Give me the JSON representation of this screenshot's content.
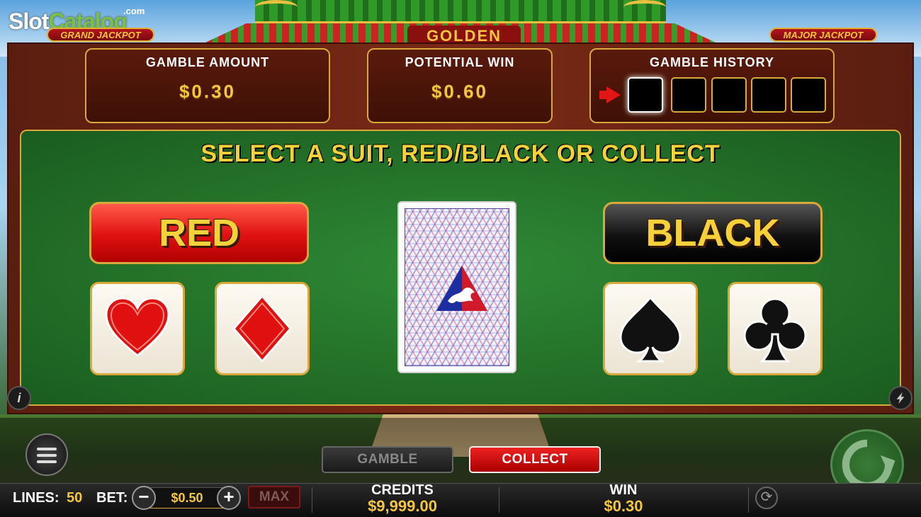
{
  "watermark": {
    "brand_a": "Slot",
    "brand_b": "Catalog",
    "suffix": ".com"
  },
  "header": {
    "grand_jackpot": "GRAND JACKPOT",
    "golden_sign": "GOLDEN",
    "major_jackpot": "MAJOR JACKPOT"
  },
  "panels": {
    "gamble_amount": {
      "label": "GAMBLE  AMOUNT",
      "value": "$0.30"
    },
    "potential_win": {
      "label": "POTENTIAL  WIN",
      "value": "$0.60"
    },
    "gamble_history": {
      "label": "GAMBLE  HISTORY",
      "slots": 5,
      "active_slot": 1
    }
  },
  "game": {
    "instruction": "SELECT A SUIT, RED/BLACK OR COLLECT",
    "red_label": "RED",
    "black_label": "BLACK",
    "suits": [
      "heart-icon",
      "diamond-icon",
      "spade-icon",
      "club-icon"
    ],
    "colors": {
      "red": "#e01010",
      "black": "#111111",
      "gold": "#f3c63c",
      "felt": "#2f8a35"
    }
  },
  "controls": {
    "gamble_label": "GAMBLE",
    "collect_label": "COLLECT",
    "info_icon_label": "i"
  },
  "status": {
    "lines_label": "LINES:",
    "lines_value": "50",
    "bet_label": "BET:",
    "bet_value": "$0.50",
    "minus": "−",
    "plus": "+",
    "max_label": "MAX",
    "credits_label": "CREDITS",
    "credits_value": "$9,999.00",
    "win_label": "WIN",
    "win_value": "$0.30"
  }
}
